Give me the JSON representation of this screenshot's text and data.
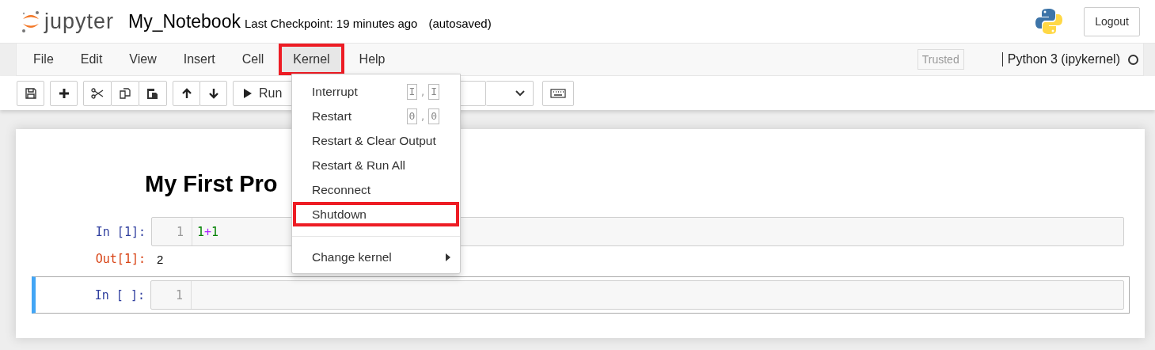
{
  "header": {
    "logo_text": "jupyter",
    "notebook_name": "My_Notebook",
    "checkpoint": "Last Checkpoint: 19 minutes ago",
    "autosave": "(autosaved)",
    "logout": "Logout"
  },
  "menubar": {
    "menus": [
      {
        "label": "File",
        "selected": false
      },
      {
        "label": "Edit",
        "selected": false
      },
      {
        "label": "View",
        "selected": false
      },
      {
        "label": "Insert",
        "selected": false
      },
      {
        "label": "Cell",
        "selected": false
      },
      {
        "label": "Kernel",
        "selected": true
      },
      {
        "label": "Help",
        "selected": false
      }
    ],
    "trusted": "Trusted",
    "kernel_name": "Python 3 (ipykernel)"
  },
  "toolbar": {
    "run_label": "Run"
  },
  "kernel_menu": {
    "items": [
      {
        "kind": "item",
        "label": "Interrupt",
        "keys": [
          "I",
          "I"
        ],
        "key_separator": ",",
        "selected": false
      },
      {
        "kind": "item",
        "label": "Restart",
        "keys": [
          "0",
          "0"
        ],
        "key_separator": ",",
        "selected": false
      },
      {
        "kind": "item",
        "label": "Restart & Clear Output",
        "selected": false
      },
      {
        "kind": "item",
        "label": "Restart & Run All",
        "selected": false
      },
      {
        "kind": "item",
        "label": "Reconnect",
        "selected": false
      },
      {
        "kind": "item",
        "label": "Shutdown",
        "selected": true
      },
      {
        "kind": "divider"
      },
      {
        "kind": "submenu",
        "label": "Change kernel",
        "selected": false
      }
    ]
  },
  "notebook": {
    "heading": "My First Pro",
    "cells": [
      {
        "prompt": "In [1]:",
        "line_number": "1",
        "selected": false,
        "code": [
          {
            "kind": "number",
            "text": "1"
          },
          {
            "kind": "operator",
            "text": "+"
          },
          {
            "kind": "number",
            "text": "1"
          }
        ],
        "output_prompt": "Out[1]:",
        "output": "2"
      },
      {
        "prompt": "In [ ]:",
        "line_number": "1",
        "selected": true
      }
    ]
  }
}
